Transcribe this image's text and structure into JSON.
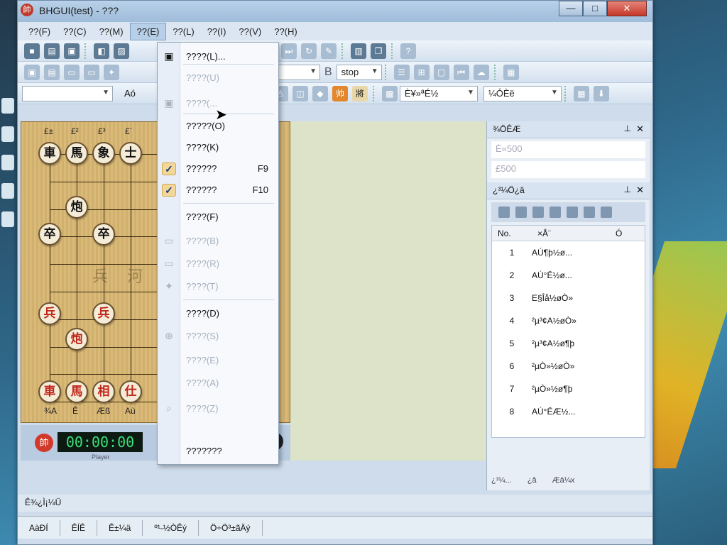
{
  "window": {
    "title": "BHGUI(test) - ???",
    "controls": {
      "minimize": "—",
      "maximize": "□",
      "close": "✕"
    }
  },
  "menubar": [
    {
      "label": "??(F)"
    },
    {
      "label": "??(C)"
    },
    {
      "label": "??(M)"
    },
    {
      "label": "??(E)",
      "active": true
    },
    {
      "label": "??(L)"
    },
    {
      "label": "??(I)"
    },
    {
      "label": "??(V)"
    },
    {
      "label": "??(H)"
    }
  ],
  "toolbar": {
    "stop_label": "stop",
    "engine_b": "B",
    "row3_combo1": "È¥»ªÉ½",
    "row3_combo2": "¼ÓÈë",
    "row3_left": "Aó"
  },
  "dropdown": {
    "items": [
      {
        "label": "????(L)...",
        "disabled": false
      },
      {
        "label": "????(U)",
        "disabled": true
      },
      {
        "label": "????(...",
        "disabled": true
      },
      {
        "label": "?????(O)",
        "disabled": false
      },
      {
        "label": "????(K)",
        "disabled": false
      },
      {
        "label": "??????",
        "shortcut": "F9",
        "checked": true
      },
      {
        "label": "??????",
        "shortcut": "F10",
        "checked": true
      },
      {
        "label": "????(F)",
        "disabled": false
      },
      {
        "label": "????(B)",
        "disabled": true
      },
      {
        "label": "????(R)",
        "disabled": true
      },
      {
        "label": "????(T)",
        "disabled": true
      },
      {
        "label": "????(D)",
        "disabled": false
      },
      {
        "label": "????(S)",
        "disabled": true
      },
      {
        "label": "????(E)",
        "disabled": true
      },
      {
        "label": "????(A)",
        "disabled": true
      },
      {
        "label": "????(Z)",
        "disabled": true
      },
      {
        "label": "???????",
        "disabled": false
      }
    ]
  },
  "board": {
    "river_text": "兵 河",
    "top_coords": [
      "£±",
      "£²",
      "£³",
      "£´"
    ],
    "bottom_coords": [
      "¾A",
      "Ê",
      "Æß",
      "Aù"
    ],
    "pieces": [
      {
        "char": "車",
        "side": "black"
      },
      {
        "char": "馬",
        "side": "black"
      },
      {
        "char": "象",
        "side": "black"
      },
      {
        "char": "士",
        "side": "black"
      },
      {
        "char": "炮",
        "side": "black"
      },
      {
        "char": "卒",
        "side": "black"
      },
      {
        "char": "卒",
        "side": "black"
      },
      {
        "char": "兵",
        "side": "red"
      },
      {
        "char": "兵",
        "side": "red"
      },
      {
        "char": "炮",
        "side": "red"
      },
      {
        "char": "車",
        "side": "red"
      },
      {
        "char": "馬",
        "side": "red"
      },
      {
        "char": "相",
        "side": "red"
      },
      {
        "char": "仕",
        "side": "red"
      }
    ]
  },
  "clock": {
    "badge_red": "帥",
    "digits": "00:00:00",
    "player": "Player",
    "badge_black": "將"
  },
  "right_panel": {
    "score_title": "¾ÖÊÆ",
    "score_values": [
      "È«500",
      "£500"
    ],
    "moves_title": "¿³¼Ö¿â",
    "columns": [
      "No.",
      "×Å¨",
      "Ó"
    ],
    "moves": [
      {
        "no": "1",
        "move": "AÚ¶þ½ø..."
      },
      {
        "no": "2",
        "move": "AÚ°Ë½ø..."
      },
      {
        "no": "3",
        "move": "E§Îå½øÒ»"
      },
      {
        "no": "4",
        "move": "²µ³¢A½øÒ»"
      },
      {
        "no": "5",
        "move": "²µ³¢A½ø¶þ"
      },
      {
        "no": "6",
        "move": "²µÒ»½øÒ»"
      },
      {
        "no": "7",
        "move": "²µÒ»½ø¶þ"
      },
      {
        "no": "8",
        "move": "AÚ°ËÆ½..."
      }
    ],
    "bottom_tabs": [
      "¿³¼...",
      "¿â",
      "Æä¼x"
    ]
  },
  "bottom_panel_title": "Ê¾¿Ì¡¼Ü",
  "statusbar": [
    "AàÐÍ",
    "ÊÍÊ",
    "Ê±¼ä",
    "º¹-½ÒÊý",
    "Ö÷Ö³±ãÄý"
  ]
}
